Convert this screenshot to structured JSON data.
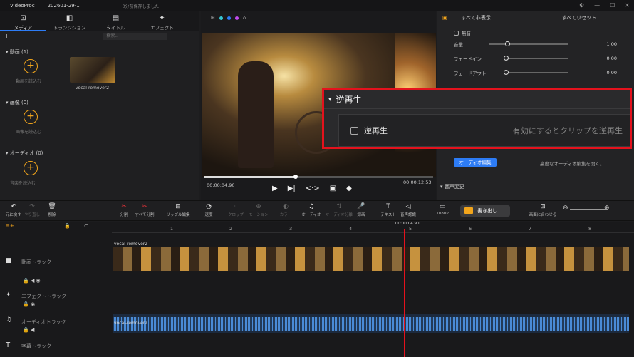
{
  "titlebar": {
    "app": "VideoProc",
    "project": "202601-29-1",
    "save_status": "0分前保存しました"
  },
  "left": {
    "tabs": [
      {
        "label": "メディア",
        "icon": "media-icon"
      },
      {
        "label": "トランジション",
        "icon": "transition-icon"
      },
      {
        "label": "タイトル",
        "icon": "title-icon"
      },
      {
        "label": "エフェクト",
        "icon": "effect-icon"
      }
    ],
    "search_placeholder": "検索...",
    "sections": [
      {
        "label": "動画",
        "count": "(1)",
        "add": "動画を読込む"
      },
      {
        "label": "画像",
        "count": "(0)",
        "add": "画像を読込む"
      },
      {
        "label": "オーディオ",
        "count": "(0)",
        "add": "音楽を読込む"
      }
    ],
    "clip_name": "vocal-remover2"
  },
  "preview": {
    "current_time": "00:00:04.90",
    "total_time": "00:00:12.53",
    "progress": 0.4
  },
  "right": {
    "show_all": "すべて非表示",
    "reset_all": "すべてリセット",
    "mute": "無音",
    "volume_label": "音量",
    "volume_value": "1.00",
    "fadein_label": "フェードイン",
    "fadein_value": "0.00",
    "fadeout_label": "フェードアウト",
    "fadeout_value": "0.00",
    "audio_edit": "オーディオ編集",
    "advanced_text": "高度なオーディオ編集を開く。",
    "pitch": "音声変更"
  },
  "popup": {
    "title": "逆再生",
    "checkbox_label": "逆再生",
    "description": "有効にするとクリップを逆再生"
  },
  "toolbar": {
    "tools": [
      {
        "label": "元に戻す",
        "icon": "undo-icon"
      },
      {
        "label": "やり直し",
        "icon": "redo-icon"
      },
      {
        "label": "削除",
        "icon": "trash-icon"
      },
      {
        "label": "分割",
        "icon": "scissors-icon"
      },
      {
        "label": "すべて分割",
        "icon": "split-all-icon"
      },
      {
        "label": "リップル編集",
        "icon": "ripple-icon"
      },
      {
        "label": "速度",
        "icon": "speed-icon"
      },
      {
        "label": "クロップ",
        "icon": "crop-icon"
      },
      {
        "label": "モーション",
        "icon": "motion-icon"
      },
      {
        "label": "カラー",
        "icon": "color-icon"
      },
      {
        "label": "オーディオ",
        "icon": "audio-icon"
      },
      {
        "label": "オーディオ分離",
        "icon": "audio-detach-icon"
      },
      {
        "label": "録画",
        "icon": "mic-icon"
      },
      {
        "label": "テキスト",
        "icon": "text-icon"
      },
      {
        "label": "音声認識",
        "icon": "speech-icon"
      },
      {
        "label": "1080P",
        "icon": "resolution-icon"
      },
      {
        "label": "画面に合わせる",
        "icon": "fit-icon"
      }
    ],
    "export_label": "書き出し"
  },
  "timeline": {
    "ticks": [
      "1",
      "2",
      "3",
      "4",
      "5",
      "6",
      "7",
      "8"
    ],
    "playhead_time": "00:00:04.90",
    "tracks": [
      {
        "name": "動画トラック"
      },
      {
        "name": "エフェクトトラック"
      },
      {
        "name": "オーディオトラック"
      },
      {
        "name": "字幕トラック"
      }
    ],
    "video_clip": "vocal-remover2",
    "audio_clip": "vocal-remover2"
  }
}
